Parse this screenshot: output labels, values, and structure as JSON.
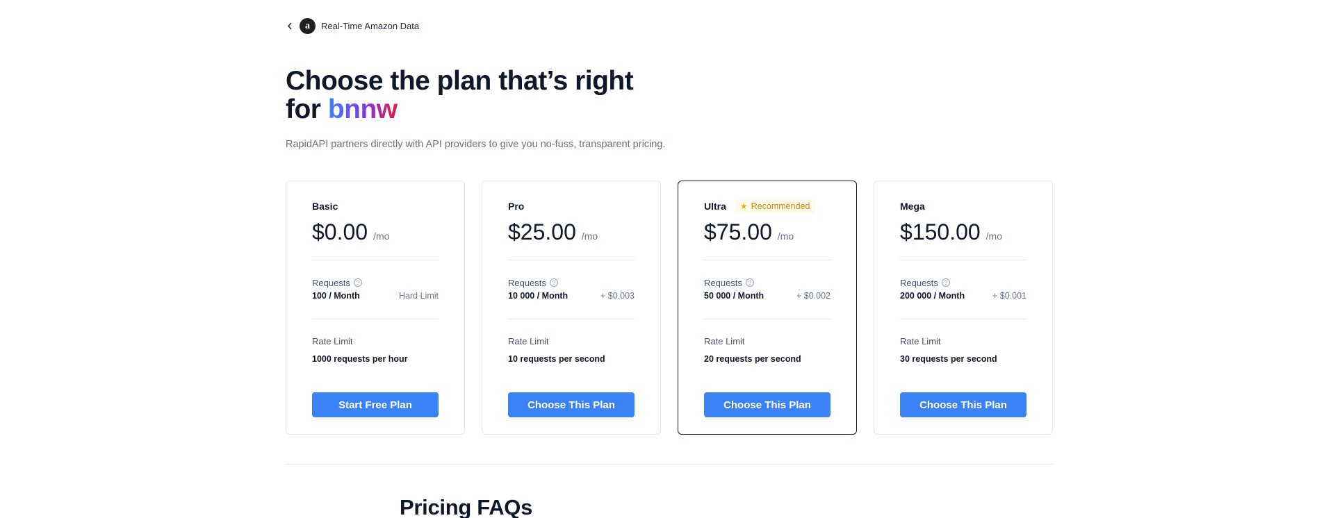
{
  "header": {
    "back_icon": "chevron-left-icon",
    "api_logo_letter": "a",
    "api_name": "Real-Time Amazon Data"
  },
  "hero": {
    "title_line1": "Choose the plan that’s right",
    "title_for": "for ",
    "title_name": "bnnw",
    "subtitle": "RapidAPI partners directly with API providers to give you no-fuss, transparent pricing."
  },
  "plans": [
    {
      "name": "Basic",
      "price": "$0.00",
      "per": "/mo",
      "requests_label": "Requests",
      "requests_value": "100 / Month",
      "requests_extra": "Hard Limit",
      "rate_label": "Rate Limit",
      "rate_value": "1000 requests per hour",
      "button": "Start Free Plan"
    },
    {
      "name": "Pro",
      "price": "$25.00",
      "per": "/mo",
      "requests_label": "Requests",
      "requests_value": "10 000 / Month",
      "requests_extra": "+ $0.003",
      "rate_label": "Rate Limit",
      "rate_value": "10 requests per second",
      "button": "Choose This Plan"
    },
    {
      "name": "Ultra",
      "badge": "Recommended",
      "price": "$75.00",
      "per": "/mo",
      "requests_label": "Requests",
      "requests_value": "50 000 / Month",
      "requests_extra": "+ $0.002",
      "rate_label": "Rate Limit",
      "rate_value": "20 requests per second",
      "button": "Choose This Plan"
    },
    {
      "name": "Mega",
      "price": "$150.00",
      "per": "/mo",
      "requests_label": "Requests",
      "requests_value": "200 000 / Month",
      "requests_extra": "+ $0.001",
      "rate_label": "Rate Limit",
      "rate_value": "30 requests per second",
      "button": "Choose This Plan"
    }
  ],
  "faq": {
    "title": "Pricing FAQs"
  },
  "colors": {
    "primary_button": "#3b82f6",
    "badge_text": "#ca8a04",
    "badge_bg": "#fffbeb"
  }
}
